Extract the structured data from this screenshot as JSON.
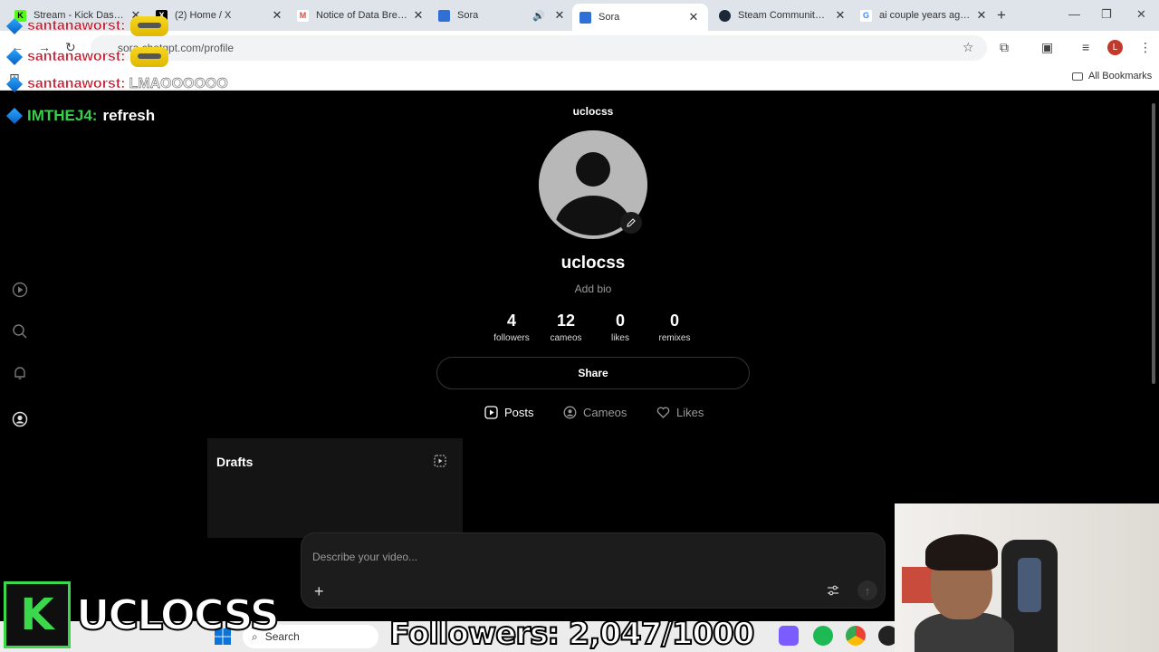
{
  "browser": {
    "tabs": [
      {
        "title": "Stream - Kick Dashboard",
        "fav_color": "#53fc18",
        "fav_text": "K"
      },
      {
        "title": "(2) Home / X",
        "fav_color": "#000000",
        "fav_text": "X"
      },
      {
        "title": "Notice of Data Breach",
        "fav_color": "#ea4335",
        "fav_text": "M"
      },
      {
        "title": "Sora",
        "fav_color": "#2f6fd6",
        "fav_text": ""
      },
      {
        "title": "Sora",
        "fav_color": "#2f6fd6",
        "fav_text": ""
      },
      {
        "title": "Steam Community :: C",
        "fav_color": "#1b2838",
        "fav_text": ""
      },
      {
        "title": "ai couple years ago -",
        "fav_color": "#4285f4",
        "fav_text": "G"
      }
    ],
    "new_tab": "+",
    "url": "sora.chatgpt.com/profile",
    "bookmarks_all": "All Bookmarks",
    "profile_initial": "L"
  },
  "chat": [
    {
      "user": "santanaworst:",
      "message": ""
    },
    {
      "user": "santanaworst:",
      "message": ""
    },
    {
      "user": "santanaworst:",
      "message": "LMAOOOOOO"
    }
  ],
  "chat_highlight": {
    "user": "IMTHEJ4:",
    "message": "refresh"
  },
  "profile": {
    "header_name": "uclocss",
    "name": "uclocss",
    "bio": "Add bio",
    "stats": [
      {
        "value": "4",
        "label": "followers"
      },
      {
        "value": "12",
        "label": "cameos"
      },
      {
        "value": "0",
        "label": "likes"
      },
      {
        "value": "0",
        "label": "remixes"
      }
    ],
    "share_label": "Share",
    "tabs": [
      {
        "label": "Posts",
        "icon": "play-square-icon"
      },
      {
        "label": "Cameos",
        "icon": "face-circle-icon"
      },
      {
        "label": "Likes",
        "icon": "heart-icon"
      }
    ],
    "drafts_title": "Drafts"
  },
  "composer": {
    "placeholder": "Describe your video..."
  },
  "taskbar": {
    "search_label": "Search"
  },
  "overlay": {
    "channel_name": "UCLOCSS",
    "followers_text": "Followers: 2,047/1000"
  },
  "colors": {
    "accent_green": "#3ad84a",
    "chat_name": "#c0182c"
  }
}
